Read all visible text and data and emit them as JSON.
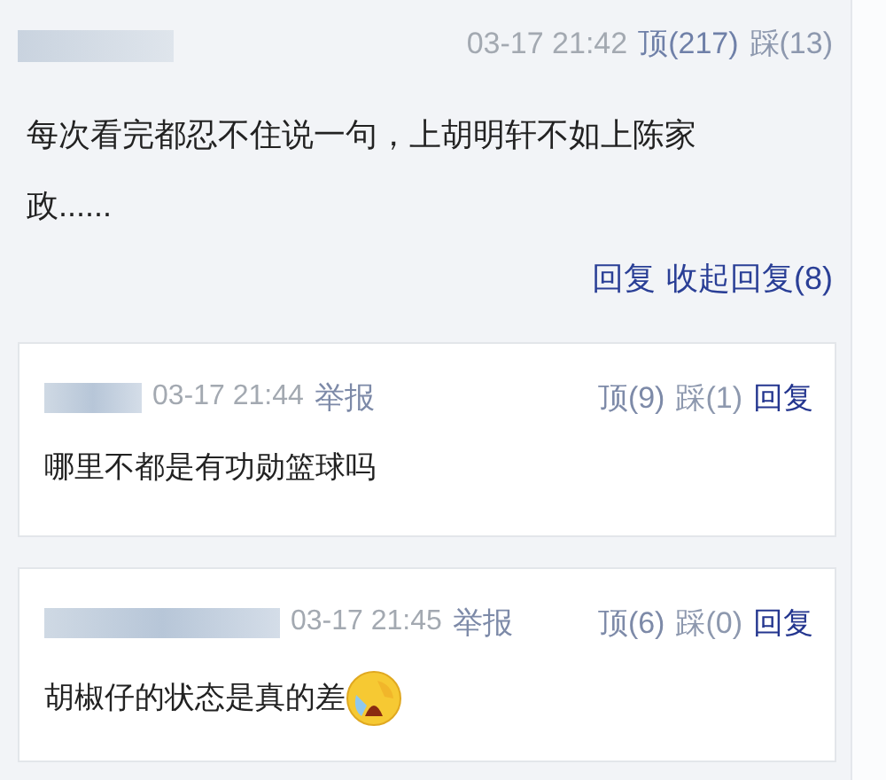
{
  "comment": {
    "time": "03-17 21:42",
    "up": "顶(217)",
    "down": "踩(13)",
    "text": "每次看完都忍不住说一句，上胡明轩不如上陈家政......",
    "reply": "回复",
    "collapse": "收起回复(8)"
  },
  "replies": [
    {
      "time": "03-17 21:44",
      "report": "举报",
      "up": "顶(9)",
      "down": "踩(1)",
      "reply": "回复",
      "text": "哪里不都是有功勋篮球吗",
      "emoji": false
    },
    {
      "time": "03-17 21:45",
      "report": "举报",
      "up": "顶(6)",
      "down": "踩(0)",
      "reply": "回复",
      "text": "胡椒仔的状态是真的差",
      "emoji": true
    }
  ]
}
